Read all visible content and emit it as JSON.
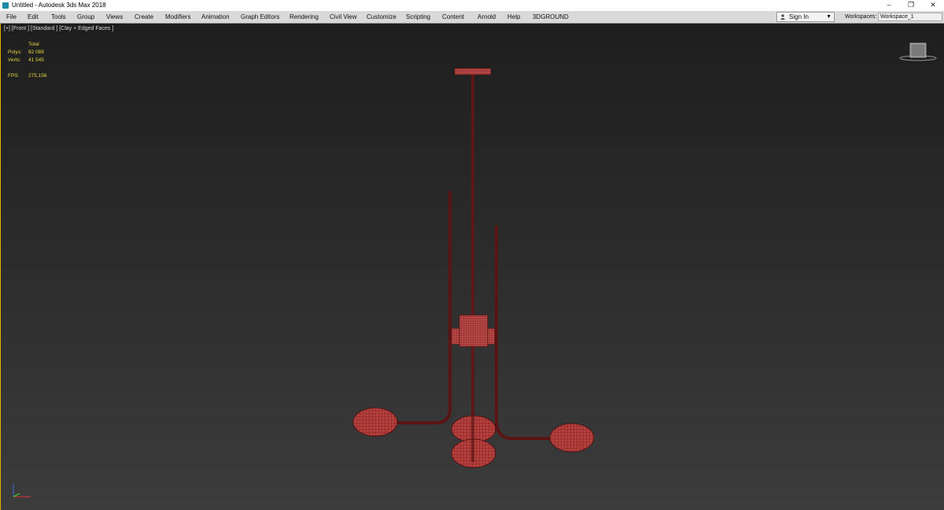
{
  "window": {
    "title": "Untitled - Autodesk 3ds Max 2018",
    "controls": {
      "minimize": "–",
      "restore": "❐",
      "close": "✕"
    }
  },
  "menubar": {
    "items": [
      "File",
      "Edit",
      "Tools",
      "Group",
      "Views",
      "Create",
      "Modifiers",
      "Animation",
      "Graph Editors",
      "Rendering",
      "Civil View",
      "Customize",
      "Scripting",
      "Content",
      "Arnold",
      "Help",
      "3DGROUND"
    ],
    "sign_in": "Sign In",
    "workspaces_label": "Workspaces:",
    "workspace_value": "Workspace_1"
  },
  "viewport": {
    "label": "[+] [Front ] [Standard ] [Clay + Edged Faces ]",
    "stats": {
      "header": "Total",
      "polys_label": "Polys:",
      "polys_value": "82 088",
      "verts_label": "Verts:",
      "verts_value": "41 545",
      "fps_label": "FPS:",
      "fps_value": "275,156"
    }
  },
  "colors": {
    "accent_border": "#e0b000",
    "stats_text": "#e6d640",
    "mesh_fill": "#b5403e",
    "mesh_wire": "#5a1010"
  }
}
